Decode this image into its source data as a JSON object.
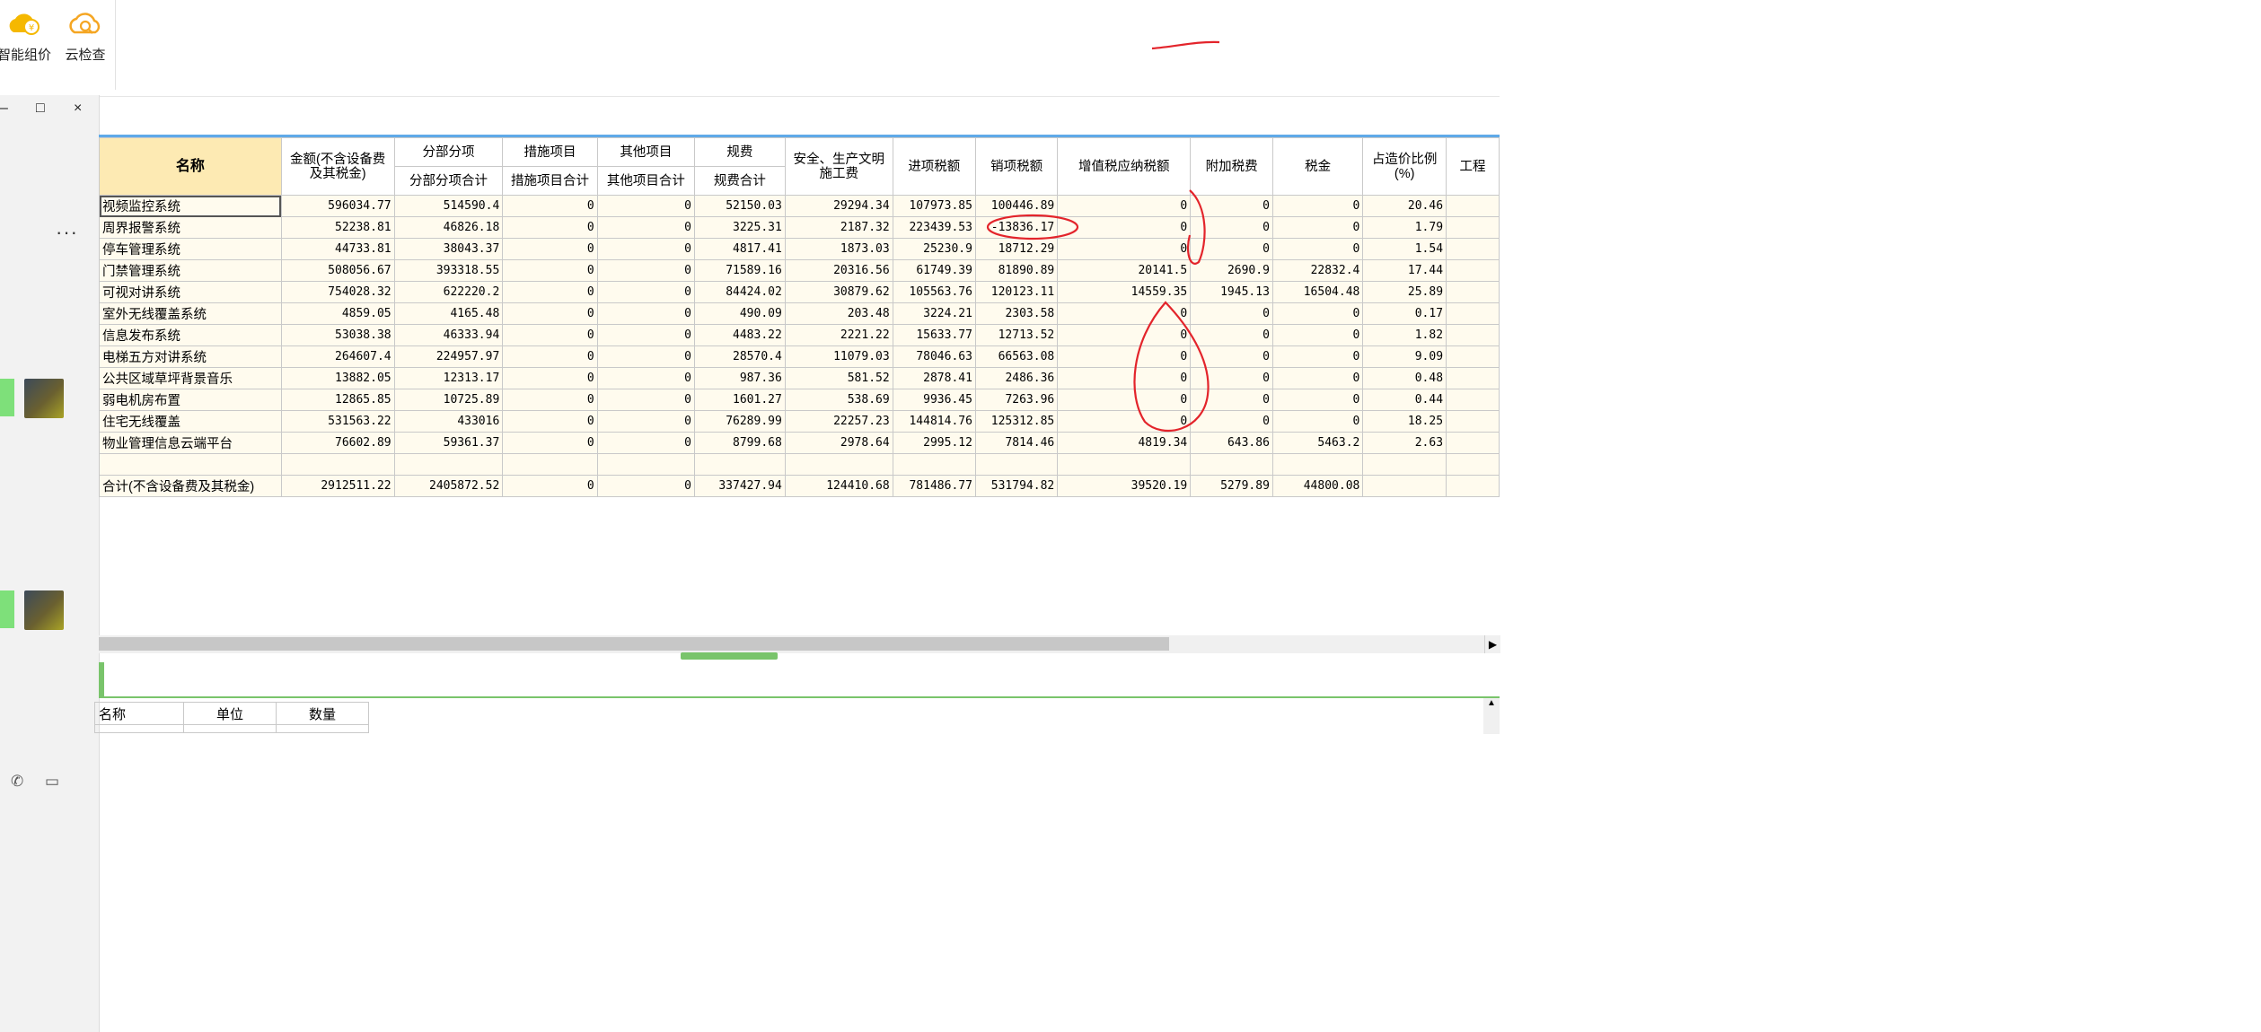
{
  "toolbar": {
    "items": [
      {
        "label": "智能组价",
        "icon": "cloud-coin-icon"
      },
      {
        "label": "云检查",
        "icon": "cloud-search-icon"
      }
    ]
  },
  "window_controls": {
    "minimize": "–",
    "maximize": "□",
    "close": "×"
  },
  "chat_panel": {
    "more": "···",
    "phone_icon": "✆",
    "video_icon": "▭"
  },
  "table": {
    "header_top": [
      "名称",
      "金额(不含设备费及其税金)",
      "分部分项",
      "措施项目",
      "其他项目",
      "规费",
      "安全、生产文明施工费",
      "进项税额",
      "销项税额",
      "增值税应纳税额",
      "附加税费",
      "税金",
      "占造价比例(%)",
      "工程"
    ],
    "header_sub": [
      "分部分项合计",
      "措施项目合计",
      "其他项目合计",
      "规费合计"
    ],
    "rows": [
      [
        "视频监控系统",
        "596034.77",
        "514590.4",
        "0",
        "0",
        "52150.03",
        "29294.34",
        "107973.85",
        "100446.89",
        "0",
        "0",
        "0",
        "20.46",
        ""
      ],
      [
        "周界报警系统",
        "52238.81",
        "46826.18",
        "0",
        "0",
        "3225.31",
        "2187.32",
        "223439.53",
        "-13836.17",
        "0",
        "0",
        "0",
        "1.79",
        ""
      ],
      [
        "停车管理系统",
        "44733.81",
        "38043.37",
        "0",
        "0",
        "4817.41",
        "1873.03",
        "25230.9",
        "18712.29",
        "0",
        "0",
        "0",
        "1.54",
        ""
      ],
      [
        "门禁管理系统",
        "508056.67",
        "393318.55",
        "0",
        "0",
        "71589.16",
        "20316.56",
        "61749.39",
        "81890.89",
        "20141.5",
        "2690.9",
        "22832.4",
        "17.44",
        ""
      ],
      [
        "可视对讲系统",
        "754028.32",
        "622220.2",
        "0",
        "0",
        "84424.02",
        "30879.62",
        "105563.76",
        "120123.11",
        "14559.35",
        "1945.13",
        "16504.48",
        "25.89",
        ""
      ],
      [
        "室外无线覆盖系统",
        "4859.05",
        "4165.48",
        "0",
        "0",
        "490.09",
        "203.48",
        "3224.21",
        "2303.58",
        "0",
        "0",
        "0",
        "0.17",
        ""
      ],
      [
        "信息发布系统",
        "53038.38",
        "46333.94",
        "0",
        "0",
        "4483.22",
        "2221.22",
        "15633.77",
        "12713.52",
        "0",
        "0",
        "0",
        "1.82",
        ""
      ],
      [
        "电梯五方对讲系统",
        "264607.4",
        "224957.97",
        "0",
        "0",
        "28570.4",
        "11079.03",
        "78046.63",
        "66563.08",
        "0",
        "0",
        "0",
        "9.09",
        ""
      ],
      [
        "公共区域草坪背景音乐",
        "13882.05",
        "12313.17",
        "0",
        "0",
        "987.36",
        "581.52",
        "2878.41",
        "2486.36",
        "0",
        "0",
        "0",
        "0.48",
        ""
      ],
      [
        "弱电机房布置",
        "12865.85",
        "10725.89",
        "0",
        "0",
        "1601.27",
        "538.69",
        "9936.45",
        "7263.96",
        "0",
        "0",
        "0",
        "0.44",
        ""
      ],
      [
        "住宅无线覆盖",
        "531563.22",
        "433016",
        "0",
        "0",
        "76289.99",
        "22257.23",
        "144814.76",
        "125312.85",
        "0",
        "0",
        "0",
        "18.25",
        ""
      ],
      [
        "物业管理信息云端平台",
        "76602.89",
        "59361.37",
        "0",
        "0",
        "8799.68",
        "2978.64",
        "2995.12",
        "7814.46",
        "4819.34",
        "643.86",
        "5463.2",
        "2.63",
        ""
      ],
      [
        "",
        "",
        "",
        "",
        "",
        "",
        "",
        "",
        "",
        "",
        "",
        "",
        "",
        ""
      ],
      [
        "合计(不含设备费及其税金)",
        "2912511.22",
        "2405872.52",
        "0",
        "0",
        "337427.94",
        "124410.68",
        "781486.77",
        "531794.82",
        "39520.19",
        "5279.89",
        "44800.08",
        "",
        ""
      ]
    ]
  },
  "subtable": {
    "headers": [
      "名称",
      "单位",
      "数量"
    ]
  },
  "colors": {
    "header_yellow": "#fdeab3",
    "cell_bg": "#fffbee",
    "accent_blue": "#5fa9e8",
    "splitter_green": "#79c46b",
    "annotation_red": "#e3242b"
  }
}
